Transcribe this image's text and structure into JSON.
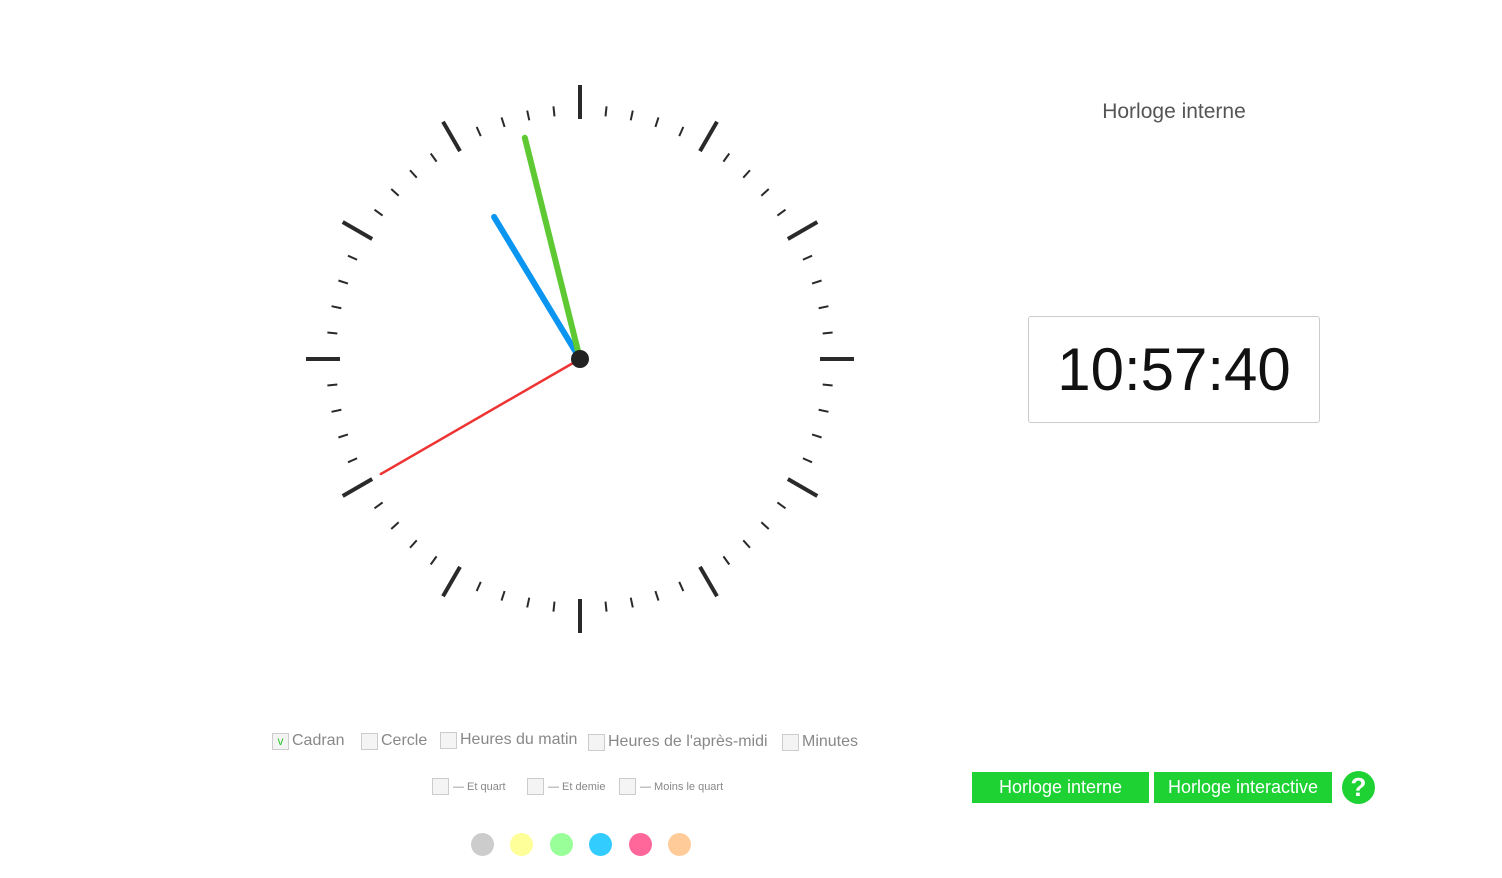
{
  "header": {
    "mode_title": "Horloge interne"
  },
  "clock": {
    "time": "10:57:40",
    "hour": 10,
    "minute": 57,
    "second": 40,
    "hour_hand_color": "#0a96f0",
    "minute_hand_color": "#5ec932",
    "second_hand_color": "#ee3333",
    "tick_color": "#2a2a2a"
  },
  "options": [
    {
      "label": "Cadran",
      "checked": true,
      "mark": "v"
    },
    {
      "label": "Cercle",
      "checked": false,
      "mark": ""
    },
    {
      "label": "Heures du matin",
      "checked": false,
      "mark": ""
    },
    {
      "label": "Heures de l'après-midi",
      "checked": false,
      "mark": ""
    },
    {
      "label": "Minutes",
      "checked": false,
      "mark": ""
    }
  ],
  "sub_options": [
    {
      "label": "— Et quart",
      "checked": false
    },
    {
      "label": "— Et demie",
      "checked": false
    },
    {
      "label": "— Moins le quart",
      "checked": false
    }
  ],
  "buttons": {
    "internal": "Horloge interne",
    "interactive": "Horloge interactive",
    "help": "?"
  },
  "swatches": [
    {
      "name": "gray",
      "color": "#cccccc"
    },
    {
      "name": "yellow",
      "color": "#ffff99"
    },
    {
      "name": "green",
      "color": "#99ff99"
    },
    {
      "name": "blue",
      "color": "#33ccff"
    },
    {
      "name": "pink",
      "color": "#ff6699"
    },
    {
      "name": "peach",
      "color": "#ffcc99"
    }
  ]
}
